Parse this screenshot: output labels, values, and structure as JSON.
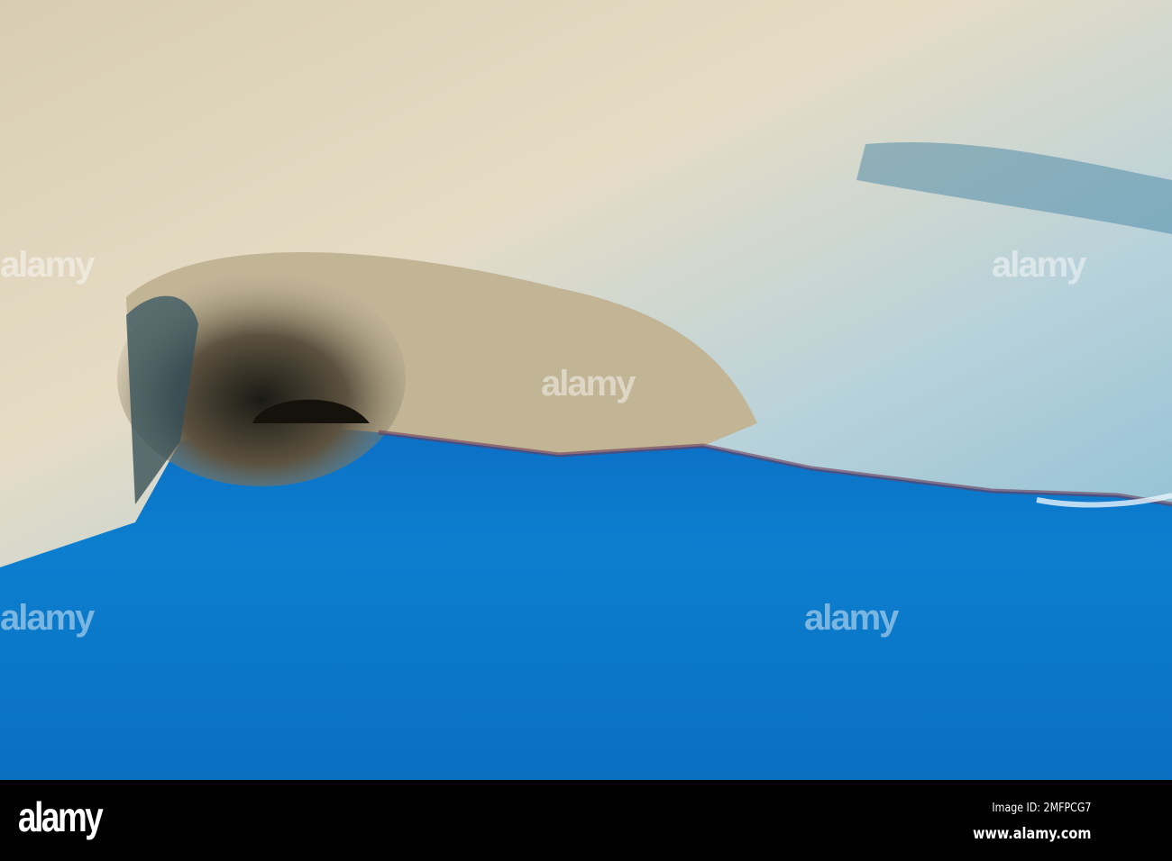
{
  "image": {
    "description_free": true
  },
  "watermark": {
    "text": "alamy"
  },
  "footer": {
    "logo": "alamy",
    "image_id": "Image ID: 2MFPCG7",
    "url": "www.alamy.com"
  }
}
